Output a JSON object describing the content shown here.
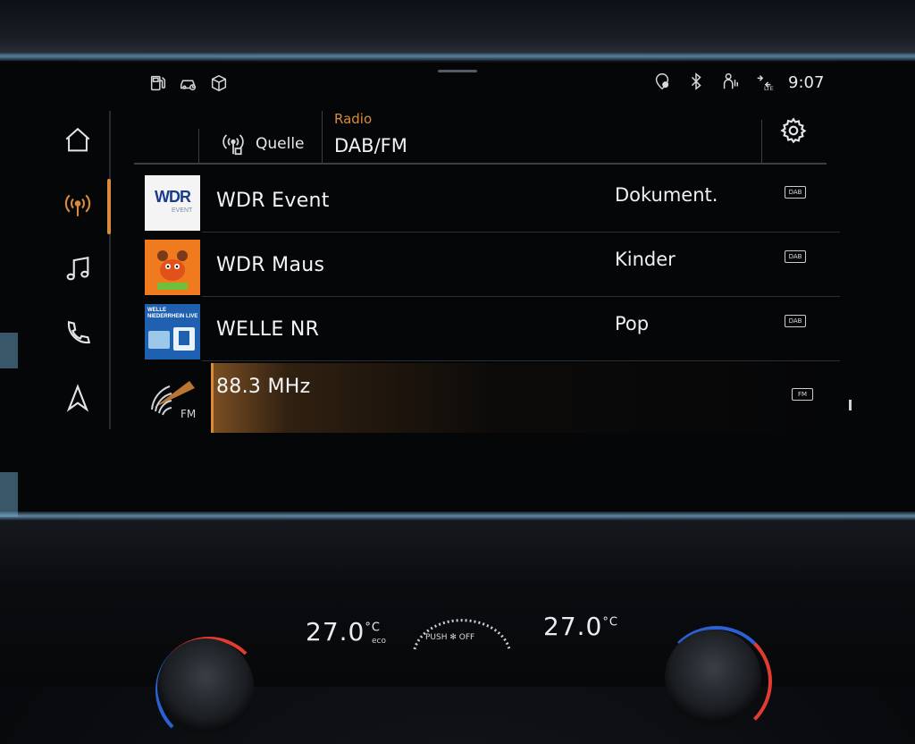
{
  "status_bar": {
    "time": "9:07",
    "left_icons": [
      "fuel-icon",
      "car-connect-icon",
      "package-icon"
    ],
    "right_icons": [
      "location-icon",
      "bluetooth-icon",
      "person-icon",
      "lte-icon"
    ]
  },
  "rail": {
    "items": [
      {
        "name": "home",
        "icon": "home-icon"
      },
      {
        "name": "radio",
        "icon": "radio-icon",
        "active": true
      },
      {
        "name": "media",
        "icon": "music-note-icon"
      },
      {
        "name": "phone",
        "icon": "phone-icon"
      },
      {
        "name": "navigation",
        "icon": "navigation-arrow-icon"
      }
    ]
  },
  "header": {
    "source_label": "Quelle",
    "caption": "Radio",
    "title": "DAB/FM",
    "settings_icon": "gear-icon"
  },
  "stations": [
    {
      "name": "WDR Event",
      "genre": "Dokument.",
      "band": "DAB",
      "logo_text": "WDR",
      "logo_subtext": "EVENT"
    },
    {
      "name": "WDR Maus",
      "genre": "Kinder",
      "band": "DAB"
    },
    {
      "name": "WELLE NR",
      "genre": "Pop",
      "band": "DAB",
      "logo_text": "WELLE NIEDERRHEIN LIVE"
    },
    {
      "name": "88.3 MHz",
      "genre": "",
      "band": "FM",
      "logo_text": "FM",
      "selected": true
    }
  ],
  "climate": {
    "left_temp": "27.0",
    "right_temp": "27.0",
    "unit": "°C",
    "mode": "eco",
    "fan_label": "PUSH ✻ OFF"
  },
  "colors": {
    "accent": "#d98a3a",
    "text": "#f3f5f7",
    "background": "#050608"
  }
}
